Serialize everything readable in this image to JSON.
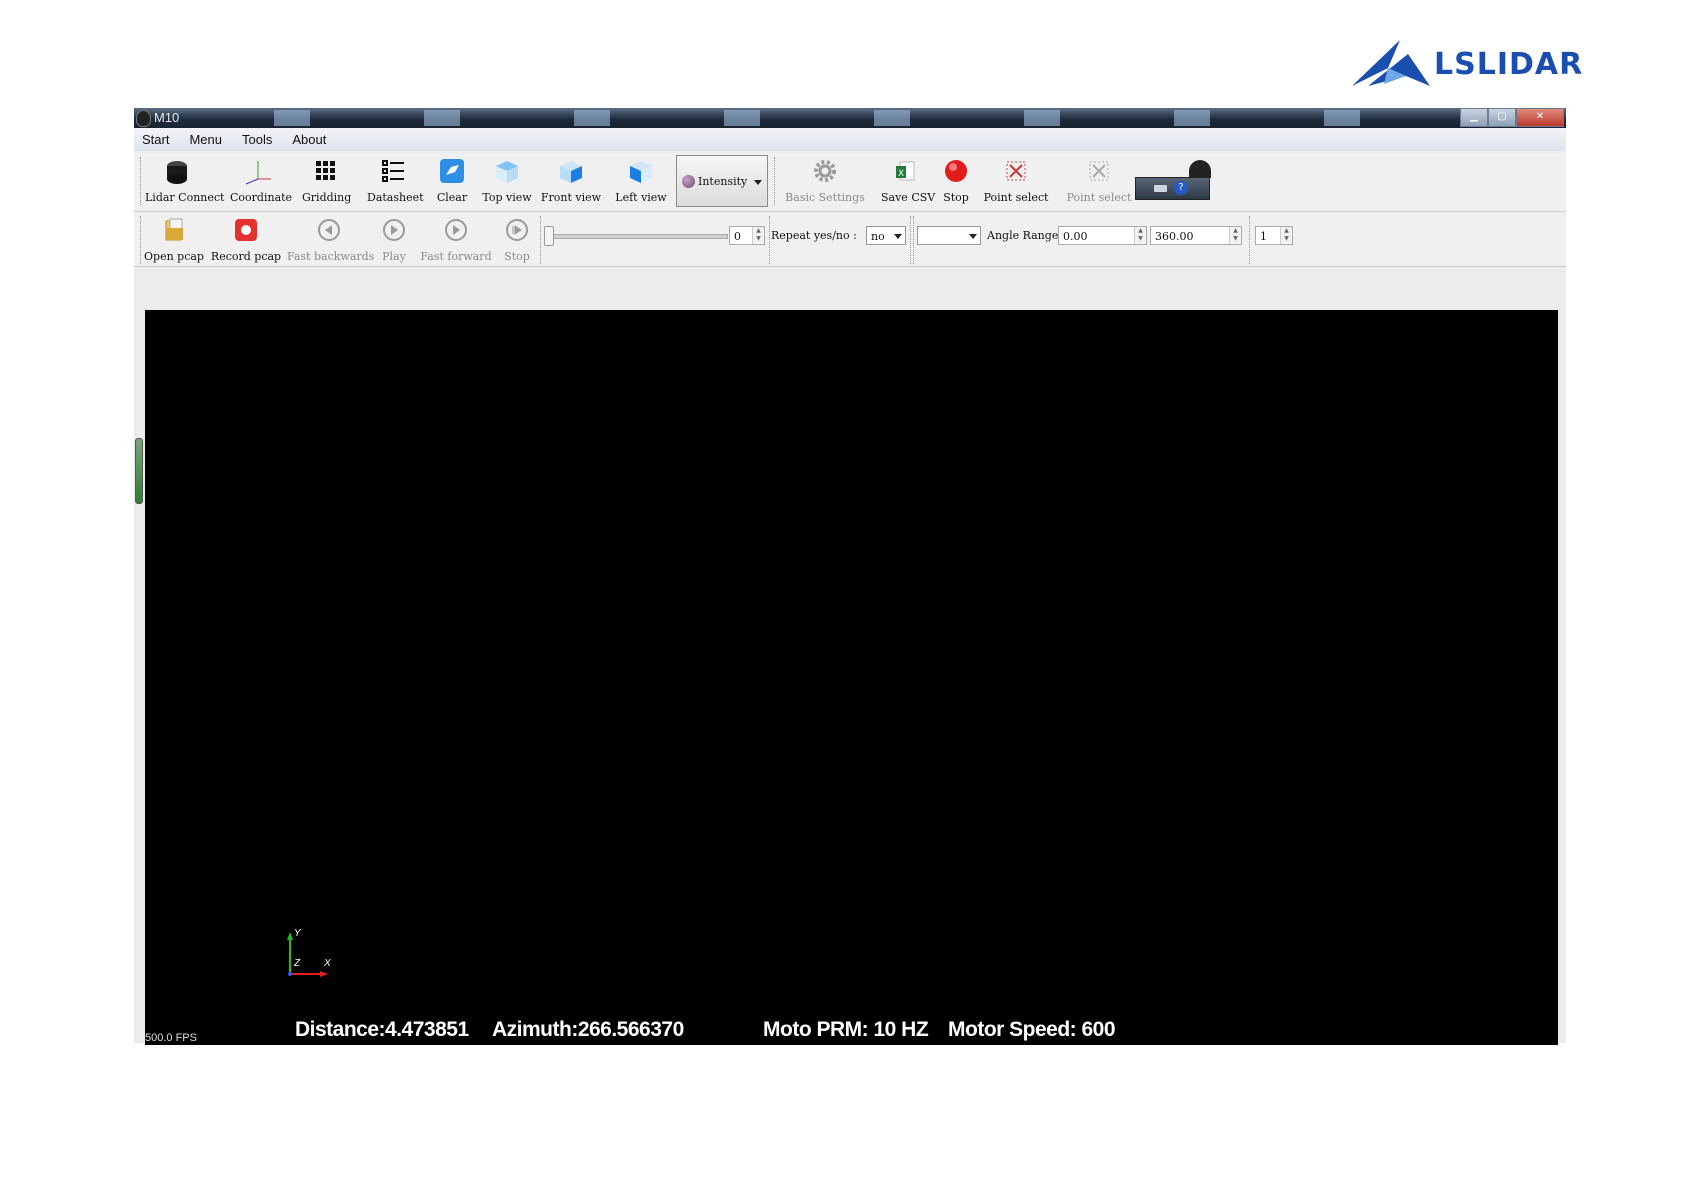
{
  "logo": {
    "text": "LSLIDAR",
    "color": "#1a4fb0"
  },
  "window": {
    "title": "M10"
  },
  "menu": [
    "Start",
    "Menu",
    "Tools",
    "About"
  ],
  "toolbar1": {
    "lidar_connect": "Lidar Connect",
    "coordinate": "Coordinate",
    "gridding": "Gridding",
    "datasheet": "Datasheet",
    "clear": "Clear",
    "top_view": "Top view",
    "front_view": "Front view",
    "left_view": "Left view",
    "color_mode": "Intensity",
    "basic_settings": "Basic Settings",
    "save_csv": "Save CSV",
    "stop": "Stop",
    "point_select": "Point select",
    "point_select_2": "Point select"
  },
  "toolbar2": {
    "open_pcap": "Open pcap",
    "record_pcap": "Record pcap",
    "fast_backwards": "Fast backwards",
    "play": "Play",
    "fast_forward": "Fast forward",
    "stop": "Stop",
    "frame_value": "0",
    "repeat_label": "Repeat  yes/no :",
    "repeat_value": "no",
    "angle_label": "Angle Range:",
    "angle_min": "0.00",
    "angle_max": "360.00",
    "step_value": "1"
  },
  "viewport": {
    "fps": "500.0 FPS",
    "distance": "Distance:4.473851",
    "azimuth": "Azimuth:266.566370",
    "moto_prm": "Moto PRM: 10 HZ",
    "motor_speed": "Motor Speed: 600",
    "axis_y": "Y",
    "axis_z": "Z",
    "axis_x": "X"
  }
}
